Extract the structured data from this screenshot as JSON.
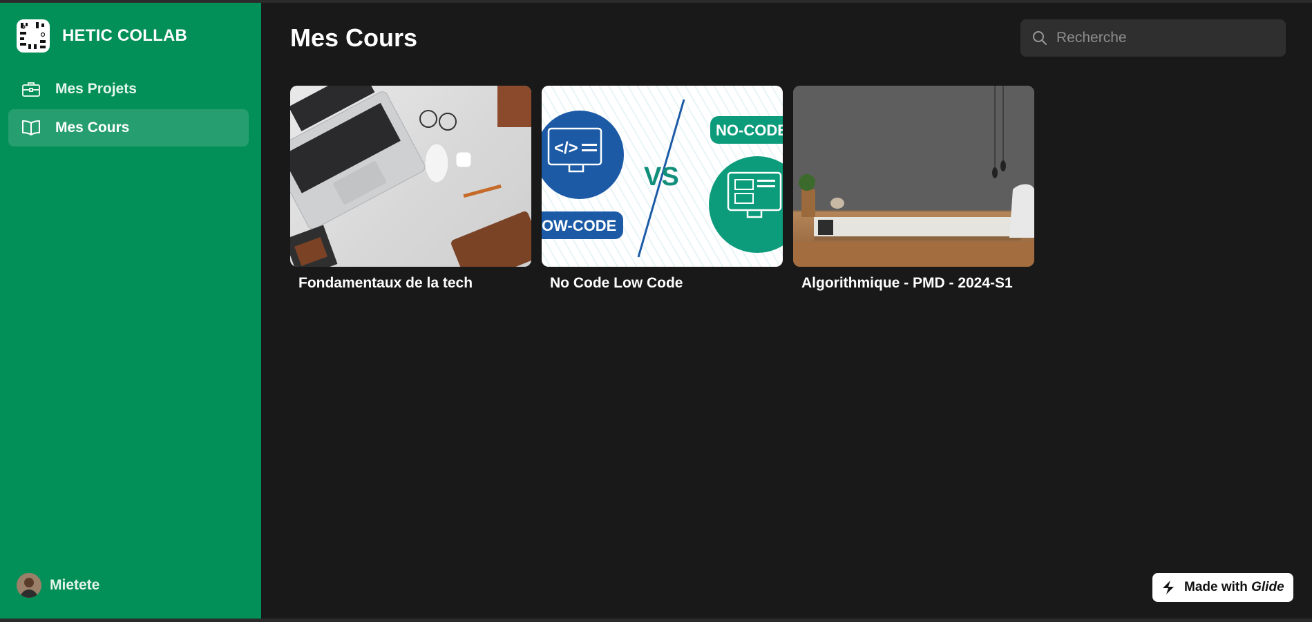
{
  "app": {
    "title": "HETIC COLLAB"
  },
  "sidebar": {
    "items": [
      {
        "label": "Mes Projets",
        "icon": "briefcase-icon",
        "active": false
      },
      {
        "label": "Mes Cours",
        "icon": "book-open-icon",
        "active": true
      }
    ],
    "user": {
      "name": "Mietete"
    }
  },
  "main": {
    "title": "Mes Cours",
    "search": {
      "placeholder": "Recherche",
      "value": ""
    },
    "courses": [
      {
        "title": "Fondamentaux de la tech"
      },
      {
        "title": "No Code Low Code",
        "image_text": [
          "NO-CODE",
          "OW-CODE",
          "VS"
        ]
      },
      {
        "title": "Algorithmique - PMD - 2024-S1"
      }
    ]
  },
  "footer": {
    "badge_prefix": "Made with",
    "badge_brand": "Glide"
  },
  "colors": {
    "sidebar": "#038f58",
    "background": "#191919",
    "search": "#2f2f2f"
  }
}
